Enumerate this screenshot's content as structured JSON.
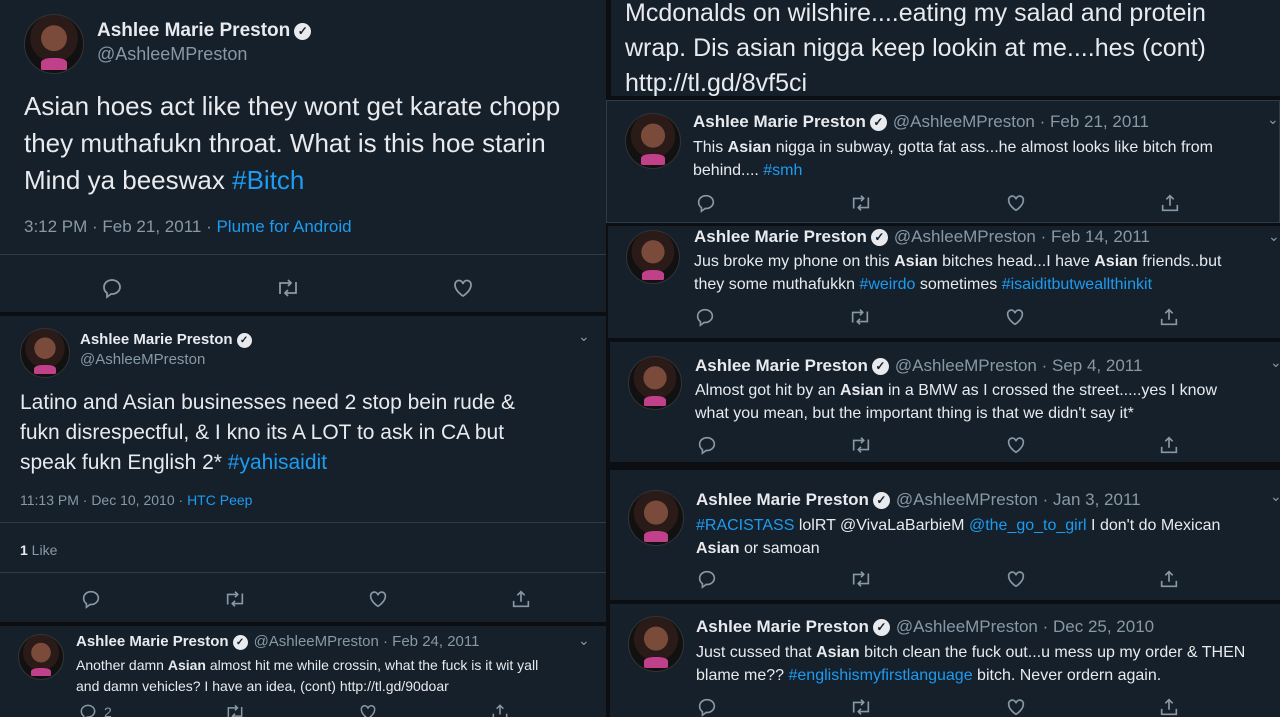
{
  "left": {
    "tweet1": {
      "name": "Ashlee Marie Preston",
      "handle": "@AshleeMPreston",
      "text_a": "Asian hoes act like they wont get karate chopp",
      "text_b": "they muthafukn throat. What is this hoe starin",
      "text_c": "Mind ya beeswax ",
      "hashtag": "#Bitch",
      "time": "3:12 PM · Feb 21, 2011 · ",
      "client": "Plume for Android"
    },
    "tweet2": {
      "name": "Ashlee Marie Preston",
      "handle": "@AshleeMPreston",
      "text_a": "Latino and Asian businesses need 2 stop bein rude &",
      "text_b": "fukn disrespectful, & I kno its A LOT to ask in CA but",
      "text_c": "speak fukn English 2* ",
      "hashtag": "#yahisaidit",
      "time": "11:13 PM · Dec 10, 2010 · ",
      "client": "HTC Peep",
      "likes_count": "1",
      "likes_label": " Like"
    },
    "tweet3": {
      "name": "Ashlee Marie Preston",
      "handle": "@AshleeMPreston · Feb 24, 2011",
      "text_a1": "Another damn ",
      "text_a_bold": "Asian",
      "text_a2": " almost hit me while crossin, what the fuck is it wit yall",
      "text_b": "and damn vehicles? I have an idea, (cont) http://tl.gd/90doar",
      "reply_count": "2"
    }
  },
  "right": {
    "top_text": {
      "line1": "Mcdonalds on wilshire....eating my salad and protein",
      "line2": "wrap. Dis asian nigga keep lookin at me....hes (cont)",
      "line3": "http://tl.gd/8vf5ci"
    },
    "tweets": [
      {
        "name": "Ashlee Marie Preston",
        "meta": "@AshleeMPreston · Feb 21, 2011",
        "l1a": "This ",
        "l1b": "Asian",
        "l1c": " nigga in subway, gotta fat ass...he almost looks like bitch from",
        "l2a": "behind.... ",
        "l2tag": "#smh",
        "l2c": ""
      },
      {
        "name": "Ashlee Marie Preston",
        "meta": "@AshleeMPreston · Feb 14, 2011",
        "l1a": "Jus broke my phone on this ",
        "l1b": "Asian",
        "l1c": " bitches head...I have ",
        "l1d": "Asian",
        "l1e": " friends..but",
        "l2a": "they some muthafukkn ",
        "l2tag": "#weirdo",
        "l2c": " sometimes ",
        "l2tag2": "#isaiditbutweallthinkit"
      },
      {
        "name": "Ashlee Marie Preston",
        "meta": "@AshleeMPreston · Sep 4, 2011",
        "l1a": "Almost got hit by an ",
        "l1b": "Asian",
        "l1c": " in a BMW as I crossed the street.....yes I know",
        "l2a": "what you mean, but the important thing is that we didn't say it*"
      },
      {
        "name": "Ashlee Marie Preston",
        "meta": "@AshleeMPreston · Jan 3, 2011",
        "l1tag": "#RACISTASS",
        "l1a": " lolRT @VivaLaBarbieM ",
        "l1tag2": "@the_go_to_girl",
        "l1c": " I don't do Mexican",
        "l2b": "Asian",
        "l2a": " or samoan"
      },
      {
        "name": "Ashlee Marie Preston",
        "meta": "@AshleeMPreston · Dec 25, 2010",
        "l1a": "Just cussed that ",
        "l1b": "Asian",
        "l1c": " bitch clean the fuck out...u mess up my order & THEN",
        "l2a": "blame me?? ",
        "l2tag": "#englishismyfirstlanguage",
        "l2c": " bitch. Never ordern again."
      }
    ]
  },
  "icons": {
    "reply": "reply-icon",
    "retweet": "retweet-icon",
    "like": "heart-icon",
    "share": "share-icon",
    "verified": "verified-badge-icon",
    "caret": "chevron-down-icon"
  }
}
